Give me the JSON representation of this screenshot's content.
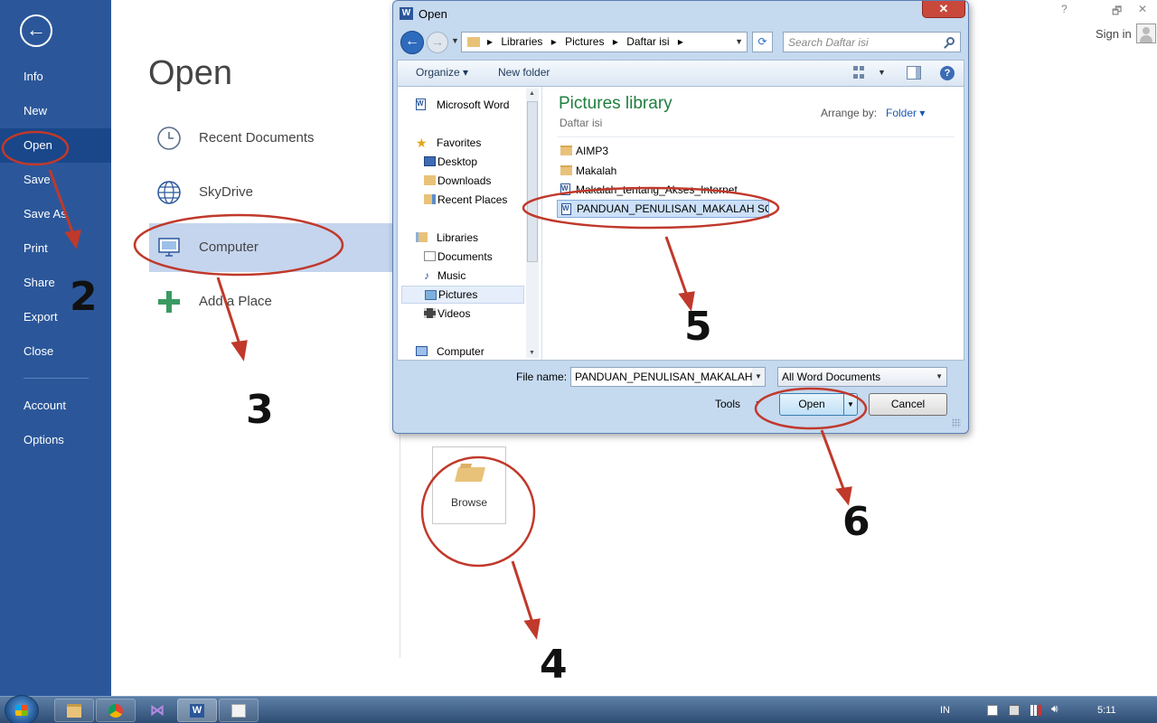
{
  "backstage": {
    "back_label": "←",
    "menu": [
      {
        "label": "Info"
      },
      {
        "label": "New"
      },
      {
        "label": "Open"
      },
      {
        "label": "Save"
      },
      {
        "label": "Save As"
      },
      {
        "label": "Print"
      },
      {
        "label": "Share"
      },
      {
        "label": "Export"
      },
      {
        "label": "Close"
      },
      {
        "label": "Account"
      },
      {
        "label": "Options"
      }
    ],
    "title": "Open",
    "places": [
      {
        "label": "Recent Documents",
        "icon": "clock-icon"
      },
      {
        "label": "SkyDrive",
        "icon": "globe-icon"
      },
      {
        "label": "Computer",
        "icon": "computer-icon"
      },
      {
        "label": "Add a Place",
        "icon": "plus-icon"
      }
    ],
    "browse_label": "Browse"
  },
  "window": {
    "signin": "Sign in",
    "help": "?",
    "restore": "🗗",
    "close": "✕"
  },
  "dialog": {
    "title": "Open",
    "close": "✕",
    "breadcrumb": [
      "Libraries",
      "Pictures",
      "Daftar isi"
    ],
    "search_placeholder": "Search Daftar isi",
    "toolbar": {
      "organize": "Organize ▾",
      "new_folder": "New folder",
      "help": "?"
    },
    "nav": [
      {
        "label": "Microsoft Word",
        "type": "hdr",
        "icon": "word-icon"
      },
      {
        "label": "Favorites",
        "type": "hdr",
        "icon": "star-icon"
      },
      {
        "label": "Desktop",
        "type": "item",
        "icon": "desktop-icon"
      },
      {
        "label": "Downloads",
        "type": "item",
        "icon": "downloads-icon"
      },
      {
        "label": "Recent Places",
        "type": "item",
        "icon": "recent-places-icon"
      },
      {
        "label": "Libraries",
        "type": "hdr",
        "icon": "libraries-icon"
      },
      {
        "label": "Documents",
        "type": "item",
        "icon": "documents-icon"
      },
      {
        "label": "Music",
        "type": "item",
        "icon": "music-icon"
      },
      {
        "label": "Pictures",
        "type": "item",
        "icon": "pictures-icon",
        "selected": true
      },
      {
        "label": "Videos",
        "type": "item",
        "icon": "videos-icon"
      },
      {
        "label": "Computer",
        "type": "hdr",
        "icon": "computer-icon"
      }
    ],
    "library_title": "Pictures library",
    "library_subtitle": "Daftar isi",
    "arrange_by_label": "Arrange by:",
    "arrange_by_value": "Folder ▾",
    "files": [
      {
        "name": "AIMP3",
        "type": "folder"
      },
      {
        "name": "Makalah",
        "type": "folder"
      },
      {
        "name": "Makalah_tentang_Akses_Internet",
        "type": "doc"
      },
      {
        "name": "PANDUAN_PENULISAN_MAKALAH SO",
        "type": "doc",
        "selected": true
      }
    ],
    "file_name_label": "File name:",
    "file_name_value": "PANDUAN_PENULISAN_MAKALAH_S",
    "file_type_value": "All Word Documents",
    "tools_label": "Tools",
    "open_button": "Open",
    "cancel_button": "Cancel"
  },
  "annotations": {
    "steps": [
      "2",
      "3",
      "4",
      "5",
      "6"
    ],
    "color": "#c0392b"
  },
  "taskbar": {
    "apps": [
      "explorer",
      "chrome",
      "visual-studio",
      "word",
      "notepad"
    ],
    "language": "IN",
    "clock": "5:11"
  }
}
